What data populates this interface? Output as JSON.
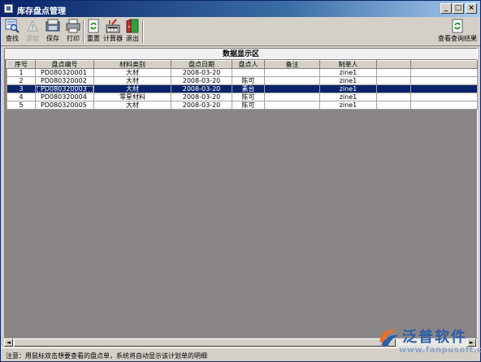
{
  "window": {
    "title": "库存盘点管理"
  },
  "toolbar": {
    "items": [
      {
        "label": "查找",
        "icon": "search-icon",
        "enabled": true
      },
      {
        "label": "添加",
        "icon": "add-icon",
        "enabled": false
      },
      {
        "label": "保存",
        "icon": "save-icon",
        "enabled": true
      },
      {
        "label": "打印",
        "icon": "printer-icon",
        "enabled": true
      },
      {
        "label": "重置",
        "icon": "refresh-icon",
        "enabled": true
      },
      {
        "label": "计算器",
        "icon": "calculator-icon",
        "enabled": true
      },
      {
        "label": "退出",
        "icon": "exit-door-icon",
        "enabled": true
      }
    ],
    "view_result_label": "查看查询结果"
  },
  "panel": {
    "title": "数据显示区"
  },
  "table": {
    "columns": [
      "序号",
      "盘点编号",
      "材料类别",
      "盘点日期",
      "盘点人",
      "备注",
      "制单人",
      "",
      ""
    ],
    "rows": [
      [
        "1",
        "PD080320001",
        "大材",
        "2008-03-20",
        "",
        "",
        "zine1",
        "",
        ""
      ],
      [
        "2",
        "PD080320002",
        "大材",
        "2008-03-20",
        "陈可",
        "",
        "zine1",
        "",
        ""
      ],
      [
        "3",
        "PD080320003",
        "大材",
        "2008-03-20",
        "素台",
        "",
        "zine1",
        "",
        ""
      ],
      [
        "4",
        "PD080320004",
        "零星材料",
        "2008-03-20",
        "陈可",
        "",
        "zine1",
        "",
        ""
      ],
      [
        "5",
        "PD080320005",
        "大材",
        "2008-03-20",
        "陈可",
        "",
        "zine1",
        "",
        ""
      ]
    ],
    "selected_row": 2
  },
  "status": {
    "text": "注意：用鼠标双击想要查看的盘点单，系统将自动显示该计划单的明细"
  },
  "brand": {
    "name": "泛普软件",
    "url": "www.fanpusoft.com"
  },
  "colors": {
    "title_start": "#0a246a",
    "title_end": "#a6caf0",
    "selection": "#0a246a",
    "workspace": "#8a8688",
    "brand": "#2c5ea8"
  }
}
